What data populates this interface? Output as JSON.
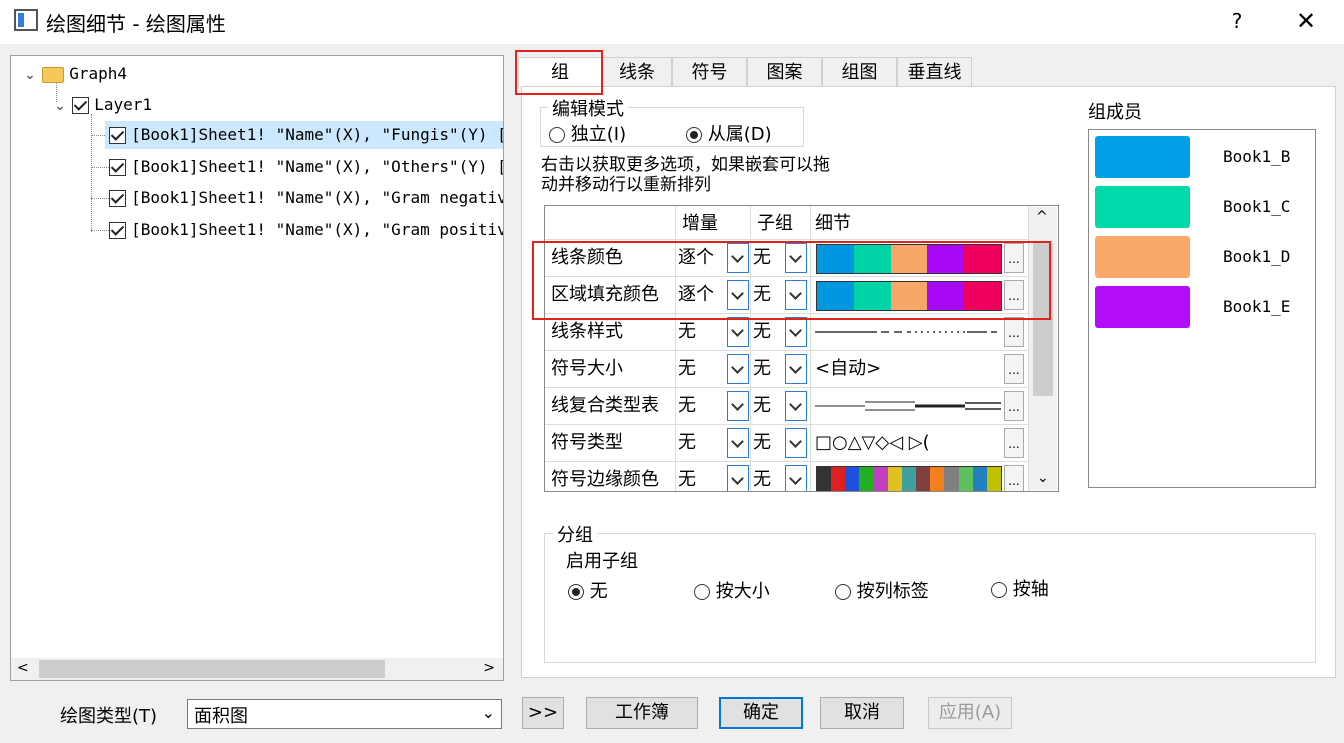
{
  "window": {
    "title": "绘图细节 - 绘图属性",
    "help_label": "?",
    "close_label": "✕"
  },
  "tree": {
    "root": "Graph4",
    "layer": "Layer1",
    "plots": [
      "[Book1]Sheet1! \"Name\"(X), \"Fungis\"(Y) [",
      "[Book1]Sheet1! \"Name\"(X), \"Others\"(Y) [",
      "[Book1]Sheet1! \"Name\"(X), \"Gram negativ",
      "[Book1]Sheet1! \"Name\"(X), \"Gram positiv"
    ]
  },
  "tabs": [
    "组",
    "线条",
    "符号",
    "图案",
    "组图",
    "垂直线"
  ],
  "edit_mode": {
    "title": "编辑模式",
    "independent": "独立(I)",
    "dependent": "从属(D)"
  },
  "hint": {
    "line1": "右击以获取更多选项，如果嵌套可以拖",
    "line2": "动并移动行以重新排列"
  },
  "grid": {
    "headers": [
      "增量",
      "子组",
      "细节"
    ],
    "rows": [
      {
        "name": "线条颜色",
        "increment": "逐个",
        "subgroup": "无",
        "detail": ""
      },
      {
        "name": "区域填充颜色",
        "increment": "逐个",
        "subgroup": "无",
        "detail": ""
      },
      {
        "name": "线条样式",
        "increment": "无",
        "subgroup": "无",
        "detail": ""
      },
      {
        "name": "符号大小",
        "increment": "无",
        "subgroup": "无",
        "detail": "<自动>"
      },
      {
        "name": "线复合类型表",
        "increment": "无",
        "subgroup": "无",
        "detail": ""
      },
      {
        "name": "符号类型",
        "increment": "无",
        "subgroup": "无",
        "detail": "□○△▽◇◁ ▷("
      },
      {
        "name": "符号边缘颜色",
        "increment": "无",
        "subgroup": "无",
        "detail": ""
      }
    ],
    "ellipsis": "...",
    "color_list": [
      "#0096e0",
      "#00d4a6",
      "#f9a66b",
      "#a90af5",
      "#f0005e"
    ],
    "multi_color_list": [
      "#333333",
      "#e02020",
      "#2050e0",
      "#20b020",
      "#c040c0",
      "#e0c020",
      "#40a0a0",
      "#804040",
      "#f08020",
      "#808080",
      "#60c060",
      "#2080c0",
      "#c0c000"
    ]
  },
  "members": {
    "title": "组成员",
    "items": [
      {
        "label": "Book1_B",
        "color": "#00a0e8"
      },
      {
        "label": "Book1_C",
        "color": "#00d9a9"
      },
      {
        "label": "Book1_D",
        "color": "#fba86b"
      },
      {
        "label": "Book1_E",
        "color": "#b20cf8"
      }
    ]
  },
  "grouping": {
    "title": "分组",
    "enable_subgroup": "启用子组",
    "options": [
      "无",
      "按大小",
      "按列标签",
      "按轴"
    ]
  },
  "bottom": {
    "plot_type_label": "绘图类型(T)",
    "plot_type_value": "面积图",
    "more_btn": ">>",
    "workbook_btn": "工作簿",
    "ok_btn": "确定",
    "cancel_btn": "取消",
    "apply_btn": "应用(A)"
  },
  "colors": {
    "highlight_box": "#e0231b",
    "selected_row": "#cce8ff"
  }
}
